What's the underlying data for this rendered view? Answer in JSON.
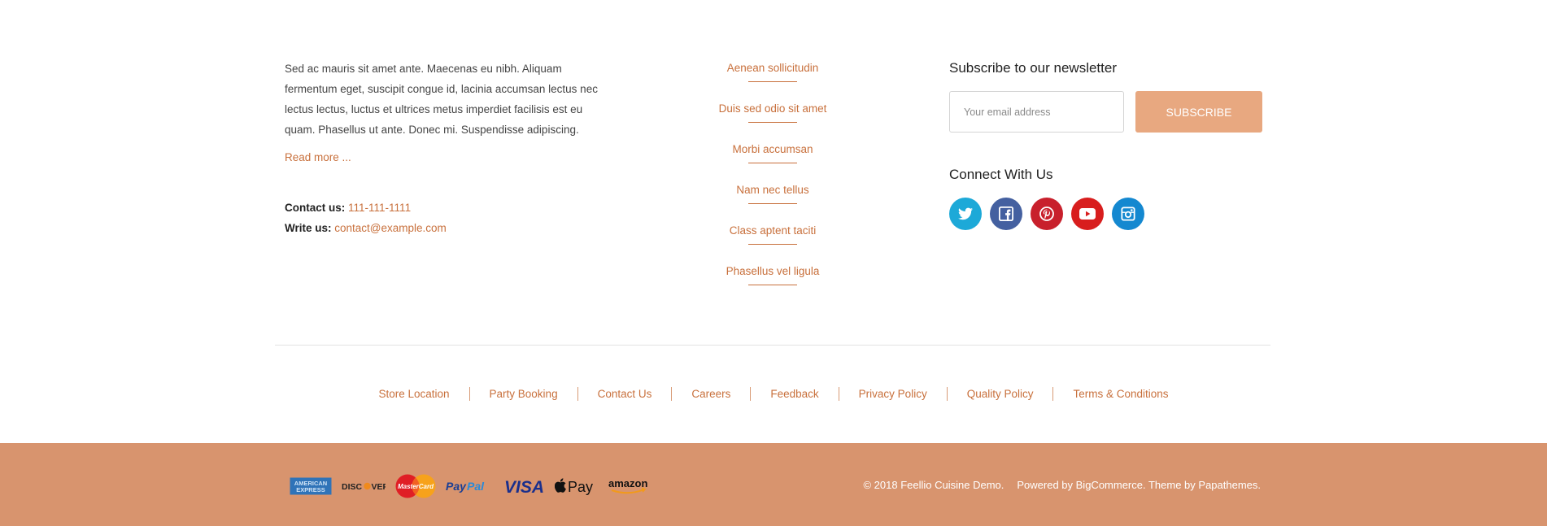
{
  "about": {
    "text": "Sed ac mauris sit amet ante. Maecenas eu nibh. Aliquam fermentum eget, suscipit congue id, lacinia accumsan lectus nec lectus lectus, luctus et ultrices metus imperdiet facilisis est eu quam. Phasellus ut ante. Donec mi. Suspendisse adipiscing.",
    "read_more": "Read more ...",
    "contact_label": "Contact us:",
    "contact_value": "111-111-1111",
    "write_label": "Write us:",
    "write_value": "contact@example.com"
  },
  "links": [
    "Aenean sollicitudin",
    "Duis sed odio sit amet",
    "Morbi accumsan",
    "Nam nec tellus",
    "Class aptent taciti",
    "Phasellus vel ligula"
  ],
  "newsletter": {
    "title": "Subscribe to our newsletter",
    "placeholder": "Your email address",
    "button": "Subscribe",
    "connect_title": "Connect With Us"
  },
  "social": [
    {
      "icon": "twitter-icon",
      "color": "#1da9d8"
    },
    {
      "icon": "facebook-icon",
      "color": "#4460a0"
    },
    {
      "icon": "pinterest-icon",
      "color": "#c8202c"
    },
    {
      "icon": "youtube-icon",
      "color": "#d81e1e"
    },
    {
      "icon": "instagram-icon",
      "color": "#1488d0"
    }
  ],
  "bottom_nav": [
    "Store Location",
    "Party Booking",
    "Contact Us",
    "Careers",
    "Feedback",
    "Privacy Policy",
    "Quality Policy",
    "Terms & Conditions"
  ],
  "payments": {
    "amex": "AMERICAN EXPRESS",
    "discover": "DISCOVER",
    "mastercard": "MasterCard",
    "paypal": "PayPal",
    "visa": "VISA",
    "applepay": "Pay",
    "amazon": "amazon"
  },
  "copyright": {
    "text": "© 2018 Feellio Cuisine Demo.",
    "powered": "Powered by BigCommerce. Theme by Papathemes."
  },
  "colors": {
    "accent": "#c8703c",
    "button": "#e8a880",
    "bar": "#d8946e"
  }
}
